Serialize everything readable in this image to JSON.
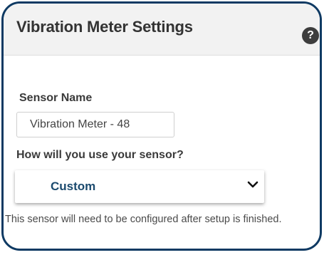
{
  "panel": {
    "title": "Vibration Meter Settings",
    "help_icon": "question-mark-circle-icon",
    "help_glyph": "?"
  },
  "sensor_name": {
    "label": "Sensor Name",
    "value": "Vibration Meter - 48"
  },
  "usage": {
    "label": "How will you use your sensor?",
    "selected": "Custom",
    "dropdown_icon": "chevron-down-icon"
  },
  "note": "This sensor will need to be configured after setup is finished.",
  "colors": {
    "border": "#0f3a63",
    "header_bg": "#f2f2f2",
    "select_text": "#1b4a6e"
  }
}
